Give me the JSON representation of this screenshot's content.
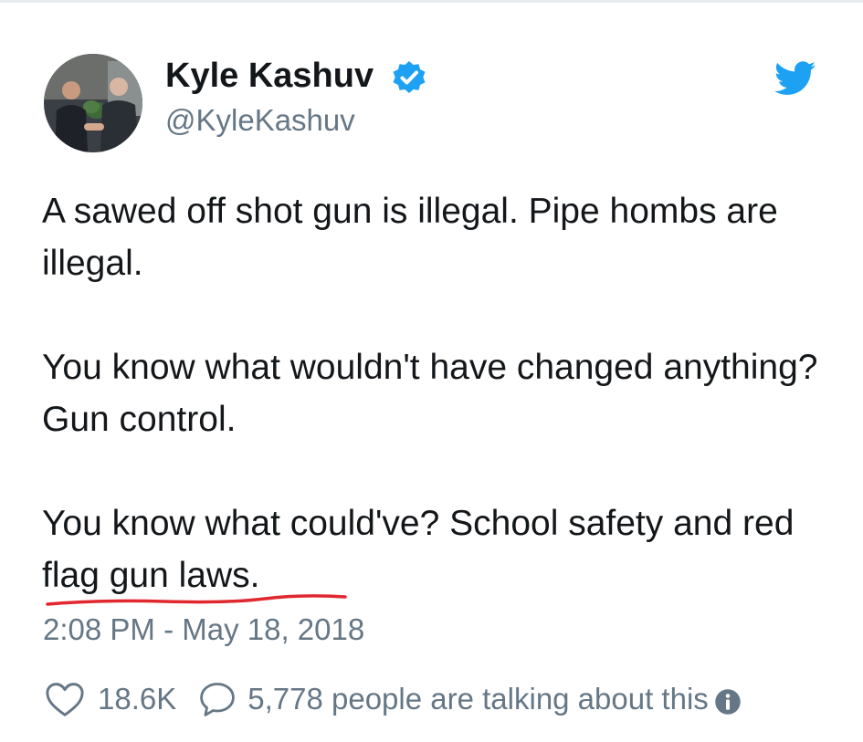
{
  "user": {
    "display_name": "Kyle Kashuv",
    "handle": "@KyleKashuv",
    "verified": true,
    "avatar_icon": "profile-photo-handshake"
  },
  "tweet": {
    "paragraphs": [
      "A sawed off shot gun is illegal. Pipe hombs are illegal.",
      "You know what wouldn't have changed anything? Gun control.",
      "You know what could've? School safety and red flag gun laws."
    ],
    "timestamp": "2:08 PM - May 18, 2018"
  },
  "actions": {
    "likes": "18.6K",
    "talking": "5,778 people are talking about this"
  },
  "icons": {
    "brand": "twitter-bird-icon",
    "like": "heart-icon",
    "reply": "speech-bubble-icon",
    "info": "info-icon",
    "verified": "verified-badge-icon"
  },
  "colors": {
    "text": "#14171a",
    "secondary": "#657786",
    "twitter_blue": "#1da1f2",
    "annotation_red": "#e0282e"
  }
}
